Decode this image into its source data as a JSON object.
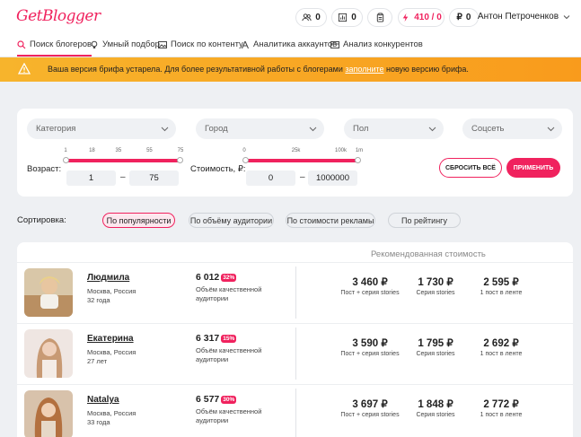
{
  "header": {
    "logo": "GetBlogger",
    "counters": [
      {
        "icon": "users-icon",
        "value": "0"
      },
      {
        "icon": "bar-chart-icon",
        "value": "0"
      },
      {
        "icon": "clipboard-icon",
        "value": ""
      },
      {
        "icon": "lightning-icon",
        "value": "410 / 0"
      },
      {
        "icon": "ruble-icon",
        "value": "0"
      }
    ],
    "user_name": "Антон Петроченков"
  },
  "tabs": [
    {
      "label": "Поиск блогеров",
      "icon": "search-icon"
    },
    {
      "label": "Умный подбор",
      "icon": "bulb-icon"
    },
    {
      "label": "Поиск по контенту",
      "icon": "image-icon"
    },
    {
      "label": "Аналитика аккаунтов",
      "icon": "account-icon"
    },
    {
      "label": "Анализ конкурентов",
      "icon": "compare-icon"
    }
  ],
  "banner": {
    "text_before": "Ваша версия брифа устарела. Для более результативной работы с блогерами ",
    "link": "заполните",
    "text_after": " новую версию брифа."
  },
  "filters": {
    "category_placeholder": "Категория",
    "city_placeholder": "Город",
    "gender_placeholder": "Пол",
    "social_placeholder": "Соцсеть",
    "age_label": "Возраст:",
    "age_ticks": [
      "1",
      "18",
      "35",
      "55",
      "75"
    ],
    "age_min": "1",
    "age_max": "75",
    "cost_label": "Стоимость, ₽:",
    "cost_ticks": [
      "0",
      "25k",
      "100k",
      "1m"
    ],
    "cost_min": "0",
    "cost_max": "1000000",
    "reset_label": "СБРОСИТЬ ВСЁ",
    "apply_label": "ПРИМЕНИТЬ"
  },
  "sort": {
    "label": "Сортировка:",
    "options": [
      "По популярности",
      "По объёму аудитории",
      "По стоимости рекламы",
      "По рейтингу"
    ],
    "active": "По популярности"
  },
  "results": {
    "recommended_title": "Рекомендованная стоимость",
    "bloggers": [
      {
        "name": "Людмила",
        "city": "Москва, Россия",
        "age": "32 года",
        "audience": "6 012",
        "badge": "32%",
        "audience_label": "Объём качественной аудитории",
        "prices": [
          {
            "value": "3 460 ₽",
            "label": "Пост + серия stories"
          },
          {
            "value": "1 730 ₽",
            "label": "Серия stories"
          },
          {
            "value": "2 595 ₽",
            "label": "1 пост в ленте"
          }
        ]
      },
      {
        "name": "Екатерина",
        "city": "Москва, Россия",
        "age": "27 лет",
        "audience": "6 317",
        "badge": "15%",
        "audience_label": "Объём качественной аудитории",
        "prices": [
          {
            "value": "3 590 ₽",
            "label": "Пост + серия stories"
          },
          {
            "value": "1 795 ₽",
            "label": "Серия stories"
          },
          {
            "value": "2 692 ₽",
            "label": "1 пост в ленте"
          }
        ]
      },
      {
        "name": "Natalya",
        "city": "Москва, Россия",
        "age": "33 года",
        "audience": "6 577",
        "badge": "30%",
        "audience_label": "Объём качественной аудитории",
        "prices": [
          {
            "value": "3 697 ₽",
            "label": "Пост + серия stories"
          },
          {
            "value": "1 848 ₽",
            "label": "Серия stories"
          },
          {
            "value": "2 772 ₽",
            "label": "1 пост в ленте"
          }
        ]
      }
    ]
  },
  "colors": {
    "accent": "#f0225e",
    "banner": "#f9a825",
    "background": "#eef0f3"
  }
}
